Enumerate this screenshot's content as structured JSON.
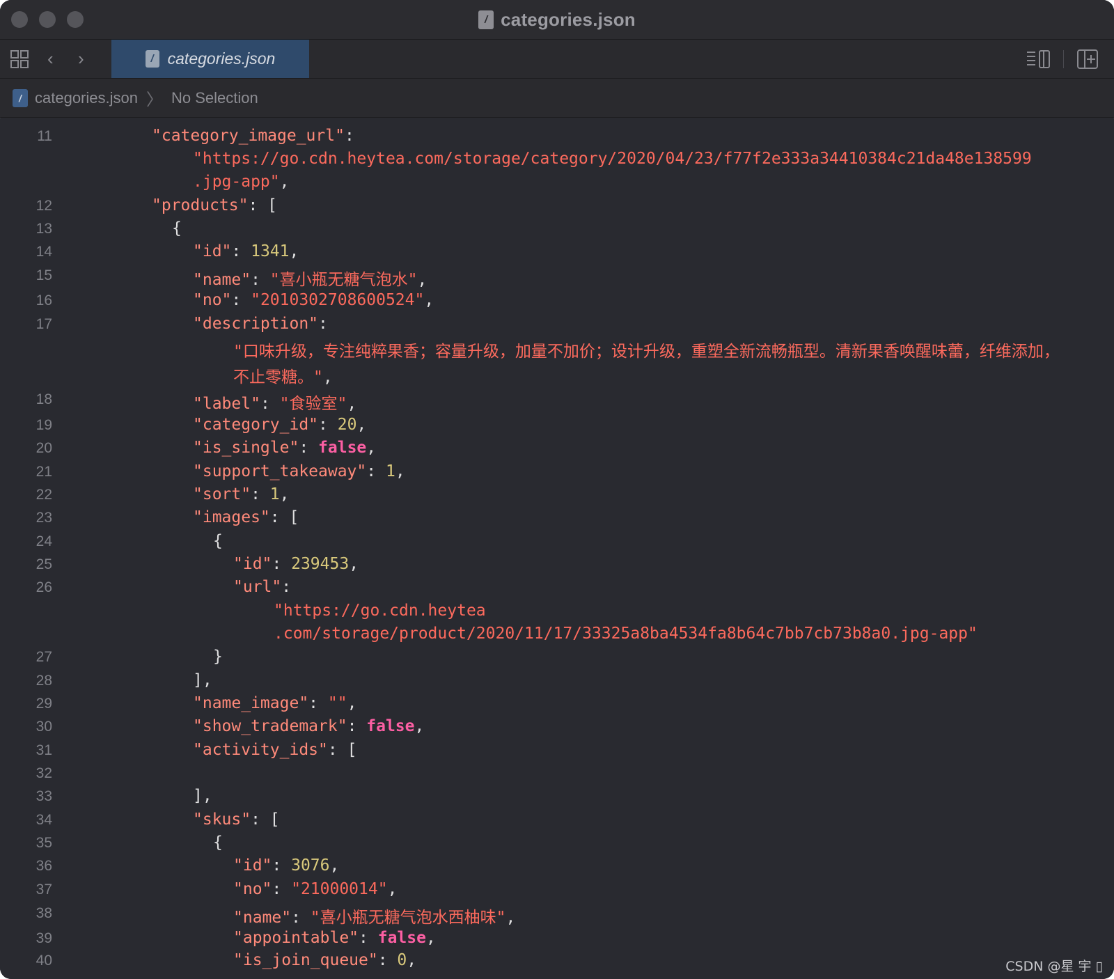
{
  "window": {
    "title": "categories.json"
  },
  "tabbar": {
    "active_tab": "categories.json"
  },
  "jumpbar": {
    "file": "categories.json",
    "selection": "No Selection"
  },
  "lines": [
    {
      "n": "11",
      "segs": [
        [
          "k",
          "\"category_image_url\""
        ],
        [
          "p",
          ":"
        ]
      ]
    },
    {
      "n": "",
      "segs": [
        [
          "s",
          "\"https://go.cdn.heytea.com/storage/category/2020/04/23/f77f2e333a34410384c21da48e138599"
        ]
      ]
    },
    {
      "n": "",
      "segs": [
        [
          "s",
          ".jpg-app\""
        ],
        [
          "p",
          ","
        ]
      ]
    },
    {
      "n": "12",
      "segs": [
        [
          "k",
          "\"products\""
        ],
        [
          "p",
          ": ["
        ]
      ]
    },
    {
      "n": "13",
      "segs": [
        [
          "p",
          "{"
        ]
      ]
    },
    {
      "n": "14",
      "segs": [
        [
          "k",
          "\"id\""
        ],
        [
          "p",
          ": "
        ],
        [
          "n",
          "1341"
        ],
        [
          "p",
          ","
        ]
      ]
    },
    {
      "n": "15",
      "segs": [
        [
          "k",
          "\"name\""
        ],
        [
          "p",
          ": "
        ],
        [
          "s",
          "\"喜小瓶无糖气泡水\""
        ],
        [
          "p",
          ","
        ]
      ]
    },
    {
      "n": "16",
      "segs": [
        [
          "k",
          "\"no\""
        ],
        [
          "p",
          ": "
        ],
        [
          "s",
          "\"2010302708600524\""
        ],
        [
          "p",
          ","
        ]
      ]
    },
    {
      "n": "17",
      "segs": [
        [
          "k",
          "\"description\""
        ],
        [
          "p",
          ":"
        ]
      ]
    },
    {
      "n": "",
      "segs": [
        [
          "s",
          "\"口味升级，专注纯粹果香；容量升级，加量不加价；设计升级，重塑全新流畅瓶型。清新果香唤醒味蕾，纤维添加，"
        ]
      ]
    },
    {
      "n": "",
      "segs": [
        [
          "s",
          "不止零糖。\""
        ],
        [
          "p",
          ","
        ]
      ]
    },
    {
      "n": "18",
      "segs": [
        [
          "k",
          "\"label\""
        ],
        [
          "p",
          ": "
        ],
        [
          "s",
          "\"食验室\""
        ],
        [
          "p",
          ","
        ]
      ]
    },
    {
      "n": "19",
      "segs": [
        [
          "k",
          "\"category_id\""
        ],
        [
          "p",
          ": "
        ],
        [
          "n",
          "20"
        ],
        [
          "p",
          ","
        ]
      ]
    },
    {
      "n": "20",
      "segs": [
        [
          "k",
          "\"is_single\""
        ],
        [
          "p",
          ": "
        ],
        [
          "b",
          "false"
        ],
        [
          "p",
          ","
        ]
      ]
    },
    {
      "n": "21",
      "segs": [
        [
          "k",
          "\"support_takeaway\""
        ],
        [
          "p",
          ": "
        ],
        [
          "n",
          "1"
        ],
        [
          "p",
          ","
        ]
      ]
    },
    {
      "n": "22",
      "segs": [
        [
          "k",
          "\"sort\""
        ],
        [
          "p",
          ": "
        ],
        [
          "n",
          "1"
        ],
        [
          "p",
          ","
        ]
      ]
    },
    {
      "n": "23",
      "segs": [
        [
          "k",
          "\"images\""
        ],
        [
          "p",
          ": ["
        ]
      ]
    },
    {
      "n": "24",
      "segs": [
        [
          "p",
          "{"
        ]
      ]
    },
    {
      "n": "25",
      "segs": [
        [
          "k",
          "\"id\""
        ],
        [
          "p",
          ": "
        ],
        [
          "n",
          "239453"
        ],
        [
          "p",
          ","
        ]
      ]
    },
    {
      "n": "26",
      "segs": [
        [
          "k",
          "\"url\""
        ],
        [
          "p",
          ":"
        ]
      ]
    },
    {
      "n": "",
      "segs": [
        [
          "s",
          "\"https://go.cdn.heytea"
        ]
      ]
    },
    {
      "n": "",
      "segs": [
        [
          "s",
          ".com/storage/product/2020/11/17/33325a8ba4534fa8b64c7bb7cb73b8a0.jpg-app\""
        ]
      ]
    },
    {
      "n": "27",
      "segs": [
        [
          "p",
          "}"
        ]
      ]
    },
    {
      "n": "28",
      "segs": [
        [
          "p",
          "],"
        ]
      ]
    },
    {
      "n": "29",
      "segs": [
        [
          "k",
          "\"name_image\""
        ],
        [
          "p",
          ": "
        ],
        [
          "s",
          "\"\""
        ],
        [
          "p",
          ","
        ]
      ]
    },
    {
      "n": "30",
      "segs": [
        [
          "k",
          "\"show_trademark\""
        ],
        [
          "p",
          ": "
        ],
        [
          "b",
          "false"
        ],
        [
          "p",
          ","
        ]
      ]
    },
    {
      "n": "31",
      "segs": [
        [
          "k",
          "\"activity_ids\""
        ],
        [
          "p",
          ": ["
        ]
      ]
    },
    {
      "n": "32",
      "segs": []
    },
    {
      "n": "33",
      "segs": [
        [
          "p",
          "],"
        ]
      ]
    },
    {
      "n": "34",
      "segs": [
        [
          "k",
          "\"skus\""
        ],
        [
          "p",
          ": ["
        ]
      ]
    },
    {
      "n": "35",
      "segs": [
        [
          "p",
          "{"
        ]
      ]
    },
    {
      "n": "36",
      "segs": [
        [
          "k",
          "\"id\""
        ],
        [
          "p",
          ": "
        ],
        [
          "n",
          "3076"
        ],
        [
          "p",
          ","
        ]
      ]
    },
    {
      "n": "37",
      "segs": [
        [
          "k",
          "\"no\""
        ],
        [
          "p",
          ": "
        ],
        [
          "s",
          "\"21000014\""
        ],
        [
          "p",
          ","
        ]
      ]
    },
    {
      "n": "38",
      "segs": [
        [
          "k",
          "\"name\""
        ],
        [
          "p",
          ": "
        ],
        [
          "s",
          "\"喜小瓶无糖气泡水西柚味\""
        ],
        [
          "p",
          ","
        ]
      ]
    },
    {
      "n": "39",
      "segs": [
        [
          "k",
          "\"appointable\""
        ],
        [
          "p",
          ": "
        ],
        [
          "b",
          "false"
        ],
        [
          "p",
          ","
        ]
      ]
    },
    {
      "n": "40",
      "segs": [
        [
          "k",
          "\"is_join_queue\""
        ],
        [
          "p",
          ": "
        ],
        [
          "n",
          "0"
        ],
        [
          "p",
          ","
        ]
      ]
    }
  ],
  "watermark": "CSDN @星  宇 ▯"
}
